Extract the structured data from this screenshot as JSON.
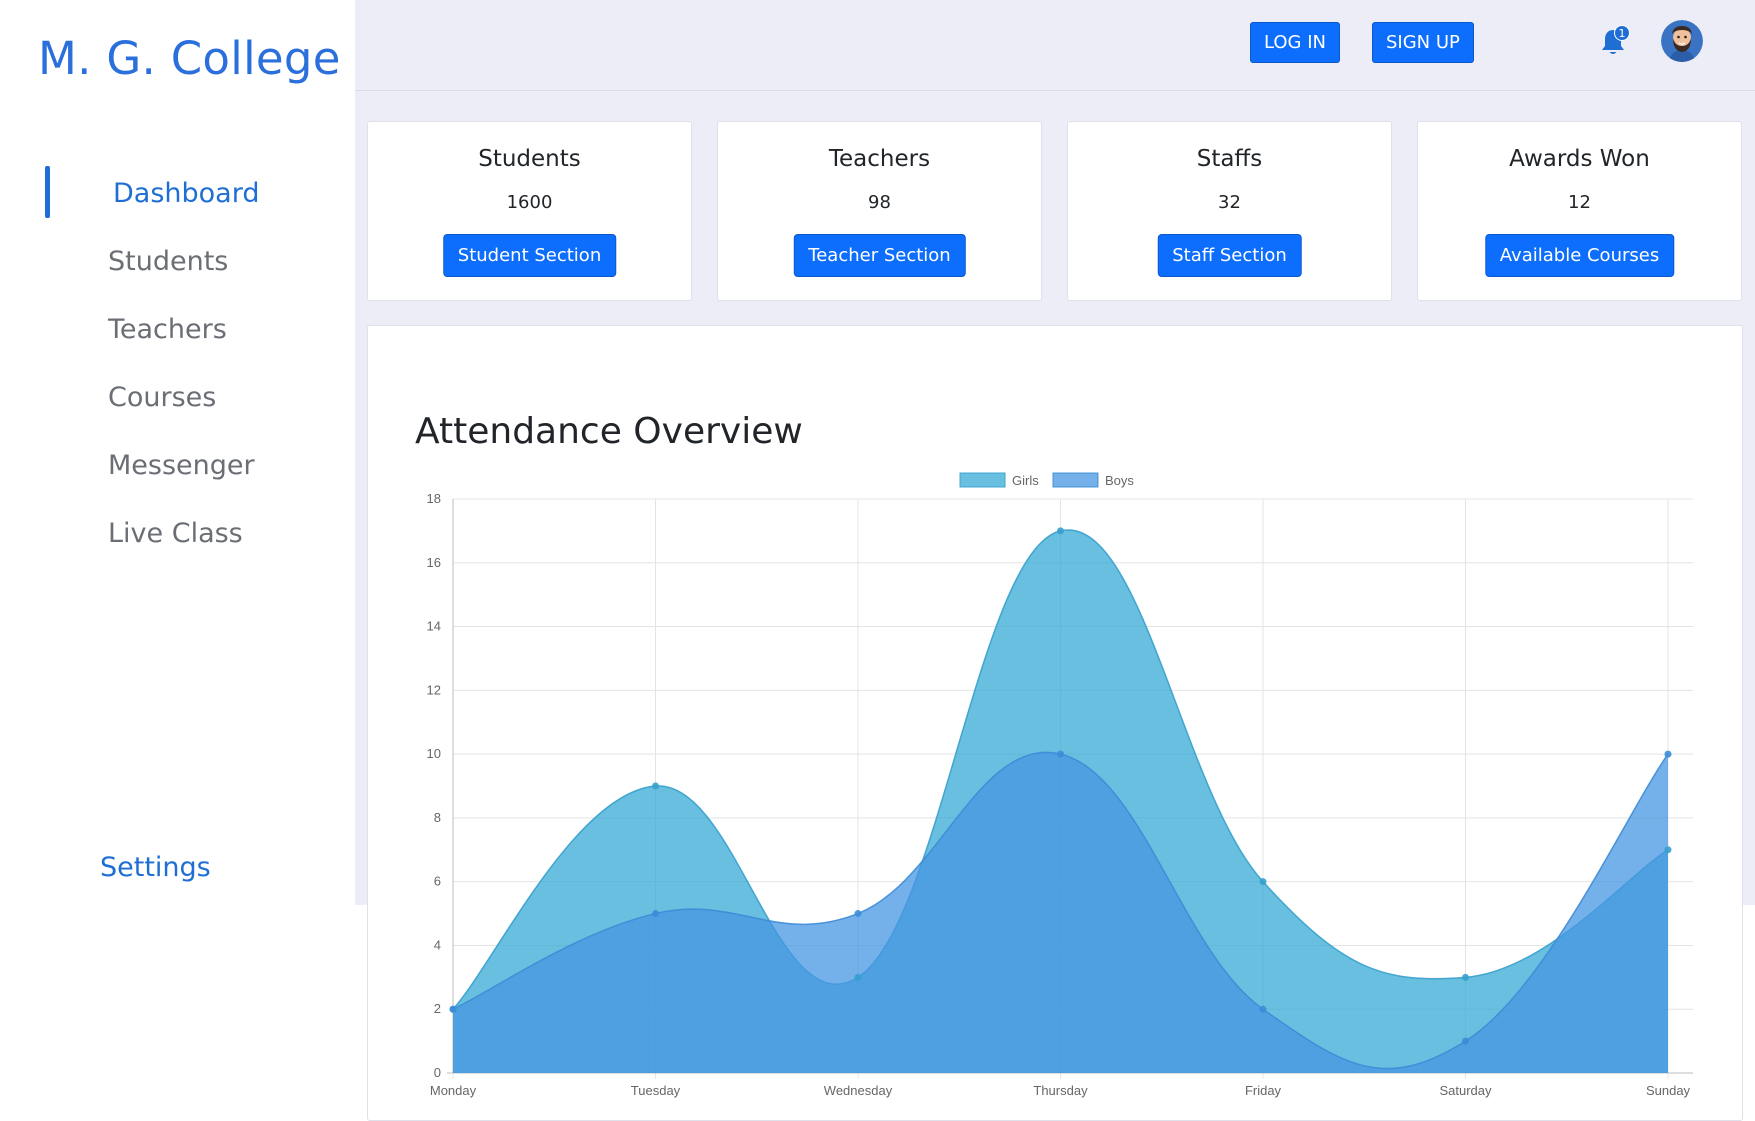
{
  "sidebar": {
    "brand": "M. G. College",
    "items": [
      {
        "label": "Dashboard",
        "active": true
      },
      {
        "label": "Students",
        "active": false
      },
      {
        "label": "Teachers",
        "active": false
      },
      {
        "label": "Courses",
        "active": false
      },
      {
        "label": "Messenger",
        "active": false
      },
      {
        "label": "Live Class",
        "active": false
      }
    ],
    "settings": "Settings"
  },
  "topbar": {
    "login": "LOG IN",
    "signup": "SIGN UP",
    "notification_count": "1",
    "bell_icon": "bell-icon",
    "avatar_icon": "bearded-man-avatar"
  },
  "cards": [
    {
      "title": "Students",
      "value": "1600",
      "button": "Student Section"
    },
    {
      "title": "Teachers",
      "value": "98",
      "button": "Teacher Section"
    },
    {
      "title": "Staffs",
      "value": "32",
      "button": "Staff Section"
    },
    {
      "title": "Awards Won",
      "value": "12",
      "button": "Available Courses"
    }
  ],
  "chart": {
    "title": "Attendance Overview"
  },
  "chart_data": {
    "type": "area",
    "title": "Attendance Overview",
    "categories": [
      "Monday",
      "Tuesday",
      "Wednesday",
      "Thursday",
      "Friday",
      "Saturday",
      "Sunday"
    ],
    "series": [
      {
        "name": "Girls",
        "values": [
          2,
          9,
          3,
          17,
          6,
          3,
          7
        ],
        "color": "#4bb8dc"
      },
      {
        "name": "Boys",
        "values": [
          2,
          5,
          5,
          10,
          2,
          1,
          10
        ],
        "color": "#5aa5e5"
      }
    ],
    "ylim": [
      0,
      18
    ],
    "yticks": [
      0,
      2,
      4,
      6,
      8,
      10,
      12,
      14,
      16,
      18
    ],
    "grid": true,
    "legend": "top-center"
  },
  "colors": {
    "primary": "#0d6efd",
    "brand": "#2a6fdb",
    "background": "#ecedf6"
  }
}
